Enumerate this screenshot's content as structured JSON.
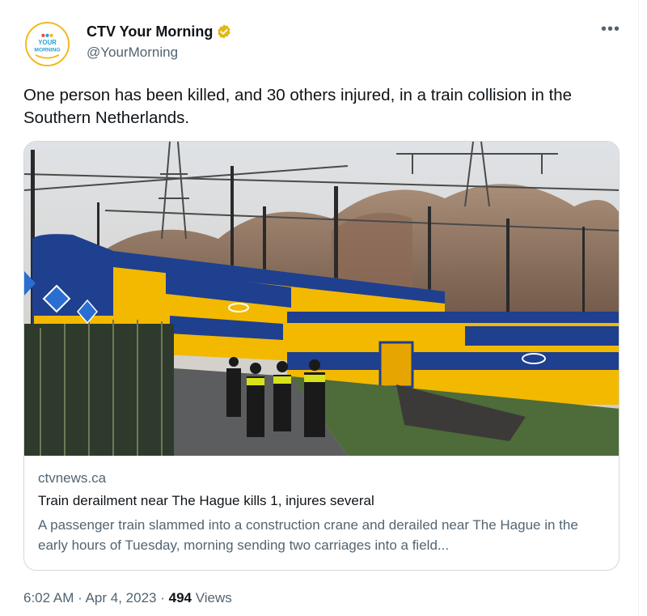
{
  "author": {
    "name": "CTV Your Morning",
    "handle": "@YourMorning",
    "avatar_text_top": "YOUR",
    "avatar_text_bottom": "MORNING",
    "verified_color": "#e2b719"
  },
  "more_icon": "more-horizontal-icon",
  "tweet": {
    "text": "One person has been killed, and 30 others injured, in a train collision in the Southern Netherlands."
  },
  "card": {
    "image_description_icon": "train-collision-photo",
    "domain": "ctvnews.ca",
    "title": "Train derailment near The Hague kills 1, injures several",
    "description": "A passenger train slammed into a construction crane and derailed near The Hague in the early hours of Tuesday, morning sending two carriages into a field..."
  },
  "meta": {
    "time": "6:02 AM",
    "separator": "·",
    "date": "Apr 4, 2023",
    "views_count": "494",
    "views_label": "Views"
  },
  "colors": {
    "text_primary": "#0f1419",
    "text_secondary": "#536471",
    "border": "#cfd9de",
    "train_yellow": "#f2b900",
    "train_blue": "#1f3f8f"
  }
}
